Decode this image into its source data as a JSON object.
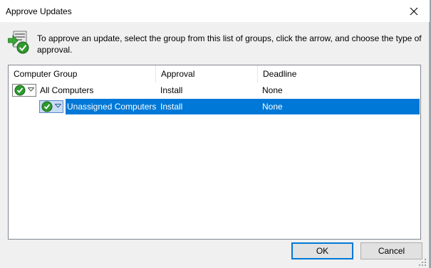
{
  "window": {
    "title": "Approve Updates",
    "instruction": "To approve an update, select the group from this list of groups, click the arrow, and choose the type of approval."
  },
  "columns": {
    "group": "Computer Group",
    "approval": "Approval",
    "deadline": "Deadline"
  },
  "rows": [
    {
      "group": "All Computers",
      "approval": "Install",
      "deadline": "None",
      "selected": false
    },
    {
      "group": "Unassigned Computers",
      "approval": "Install",
      "deadline": "None",
      "selected": true
    }
  ],
  "buttons": {
    "ok": "OK",
    "cancel": "Cancel"
  },
  "colors": {
    "selection": "#0078d7",
    "approved_check": "#2e9a2e",
    "window_bg": "#f0f0f0"
  },
  "icons": [
    "close-icon",
    "approve-updates-icon",
    "approved-check-icon",
    "dropdown-arrow-icon",
    "resize-grip-icon"
  ]
}
